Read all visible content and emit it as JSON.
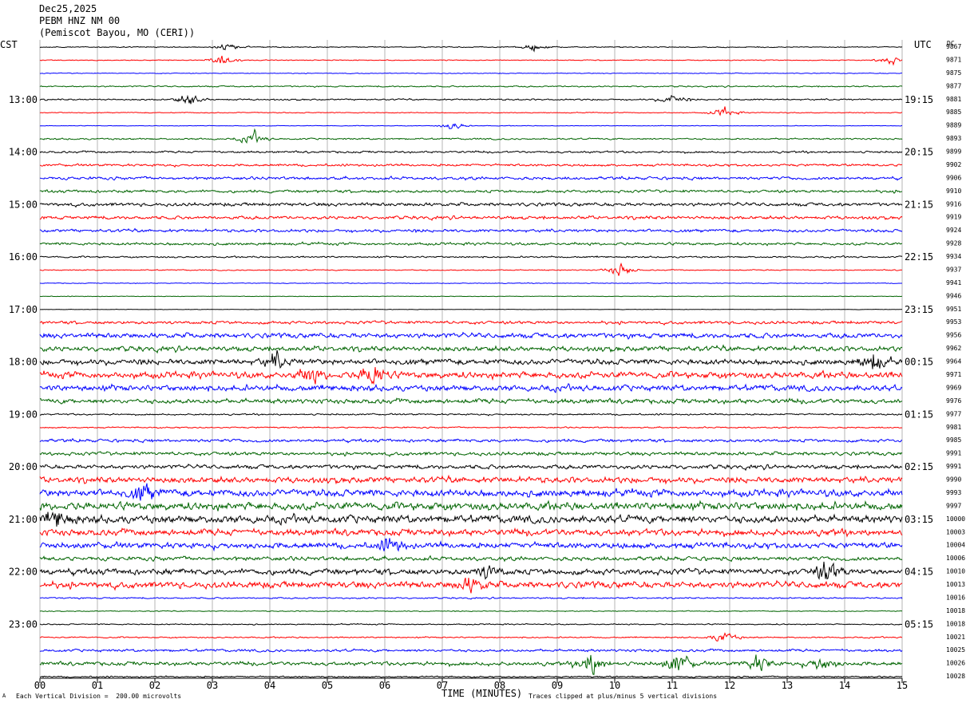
{
  "header": {
    "date": "Dec25,2025",
    "station": "PEBM HNZ NM 00",
    "location": "(Pemiscot Bayou, MO (CERI))"
  },
  "left_tz": "CST",
  "right_tz": "UTC",
  "dc_label": "DC",
  "footer": {
    "scale": "Each Vertical Division =  200.00 microvolts",
    "xlabel": "TIME (MINUTES)",
    "clip_note": "Traces clipped at plus/minus 5 vertical divisions",
    "corner_mark": "A"
  },
  "colors": {
    "cycle": [
      "#000000",
      "#ff0000",
      "#0000ff",
      "#006400"
    ],
    "grid": "#b4b4b4"
  },
  "chart_data": {
    "type": "line",
    "title": "",
    "xlabel": "TIME (MINUTES)",
    "ylabel": "",
    "x_ticks": [
      "00",
      "01",
      "02",
      "03",
      "04",
      "05",
      "06",
      "07",
      "08",
      "09",
      "10",
      "11",
      "12",
      "13",
      "14",
      "15"
    ],
    "xlim": [
      0,
      15
    ],
    "grid": true,
    "left_hour_labels": [
      "13:00",
      "14:00",
      "15:00",
      "16:00",
      "17:00",
      "18:00",
      "19:00",
      "20:00",
      "21:00",
      "22:00",
      "23:00"
    ],
    "right_hour_labels": [
      "19:15",
      "20:15",
      "21:15",
      "22:15",
      "23:15",
      "00:15",
      "01:15",
      "02:15",
      "03:15",
      "04:15",
      "05:15"
    ],
    "dc_offsets": [
      "9867",
      "9871",
      "9875",
      "9877",
      "9881",
      "9885",
      "9889",
      "9893",
      "9899",
      "9902",
      "9906",
      "9910",
      "9916",
      "9919",
      "9924",
      "9928",
      "9934",
      "9937",
      "9941",
      "9946",
      "9951",
      "9953",
      "9956",
      "9962",
      "9964",
      "9971",
      "9969",
      "9976",
      "9977",
      "9981",
      "9985",
      "9991",
      "9991",
      "9990",
      "9993",
      "9997",
      "10000",
      "10003",
      "10004",
      "10006",
      "10010",
      "10013",
      "10016",
      "10018",
      "10018",
      "10021",
      "10025",
      "10026",
      "10028"
    ],
    "trace_activity": [
      0.35,
      0.3,
      0.25,
      0.45,
      0.5,
      0.3,
      0.2,
      0.55,
      0.7,
      0.8,
      1.0,
      0.95,
      1.15,
      1.1,
      1.0,
      0.9,
      0.55,
      0.35,
      0.25,
      0.2,
      0.15,
      1.05,
      1.7,
      1.7,
      1.9,
      2.2,
      2.0,
      1.6,
      0.55,
      0.45,
      1.05,
      1.2,
      1.4,
      2.0,
      2.4,
      2.6,
      2.6,
      2.2,
      2.0,
      1.4,
      2.0,
      2.2,
      0.5,
      0.3,
      0.4,
      0.45,
      0.9,
      1.3
    ],
    "trace_events": [
      {
        "trace": 0,
        "minute": 3.3,
        "amp": 1.5
      },
      {
        "trace": 0,
        "minute": 8.6,
        "amp": 1.6
      },
      {
        "trace": 1,
        "minute": 3.2,
        "amp": 2.0
      },
      {
        "trace": 1,
        "minute": 14.8,
        "amp": 1.8
      },
      {
        "trace": 4,
        "minute": 2.6,
        "amp": 2.4
      },
      {
        "trace": 4,
        "minute": 11.0,
        "amp": 2.0
      },
      {
        "trace": 5,
        "minute": 11.9,
        "amp": 2.0
      },
      {
        "trace": 6,
        "minute": 7.2,
        "amp": 1.6
      },
      {
        "trace": 7,
        "minute": 3.7,
        "amp": 2.4
      },
      {
        "trace": 17,
        "minute": 10.1,
        "amp": 2.8
      },
      {
        "trace": 24,
        "minute": 4.1,
        "amp": 3.0
      },
      {
        "trace": 24,
        "minute": 14.5,
        "amp": 3.5
      },
      {
        "trace": 25,
        "minute": 5.8,
        "amp": 5.0
      },
      {
        "trace": 25,
        "minute": 4.7,
        "amp": 3.0
      },
      {
        "trace": 34,
        "minute": 1.8,
        "amp": 3.5
      },
      {
        "trace": 36,
        "minute": 0.3,
        "amp": 3.5
      },
      {
        "trace": 38,
        "minute": 6.1,
        "amp": 3.0
      },
      {
        "trace": 40,
        "minute": 13.7,
        "amp": 4.5
      },
      {
        "trace": 40,
        "minute": 7.8,
        "amp": 3.0
      },
      {
        "trace": 41,
        "minute": 7.5,
        "amp": 3.0
      },
      {
        "trace": 45,
        "minute": 11.9,
        "amp": 2.5
      },
      {
        "trace": 47,
        "minute": 9.6,
        "amp": 5.0
      },
      {
        "trace": 47,
        "minute": 11.1,
        "amp": 4.5
      },
      {
        "trace": 47,
        "minute": 12.5,
        "amp": 3.5
      },
      {
        "trace": 47,
        "minute": 13.6,
        "amp": 3.0
      }
    ]
  }
}
